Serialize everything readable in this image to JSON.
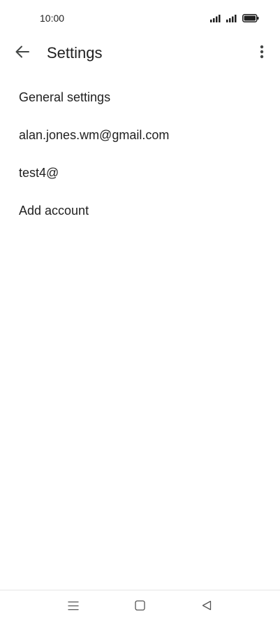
{
  "status_bar": {
    "time": "10:00",
    "icons": [
      "signal-icon",
      "signal-icon",
      "battery-icon"
    ]
  },
  "app_bar": {
    "back_icon": "arrow-back-icon",
    "title": "Settings",
    "more_icon": "more-vert-icon"
  },
  "settings": {
    "items": [
      {
        "label": "General settings"
      },
      {
        "label": "alan.jones.wm@gmail.com"
      },
      {
        "label": "test4@"
      },
      {
        "label": "Add account"
      }
    ]
  },
  "nav_bar": {
    "icons": [
      "menu-icon",
      "home-icon",
      "back-triangle-icon"
    ]
  },
  "colors": {
    "text": "#1f1f1f",
    "icon": "#444746",
    "divider": "#e6e6e6",
    "background": "#ffffff"
  }
}
